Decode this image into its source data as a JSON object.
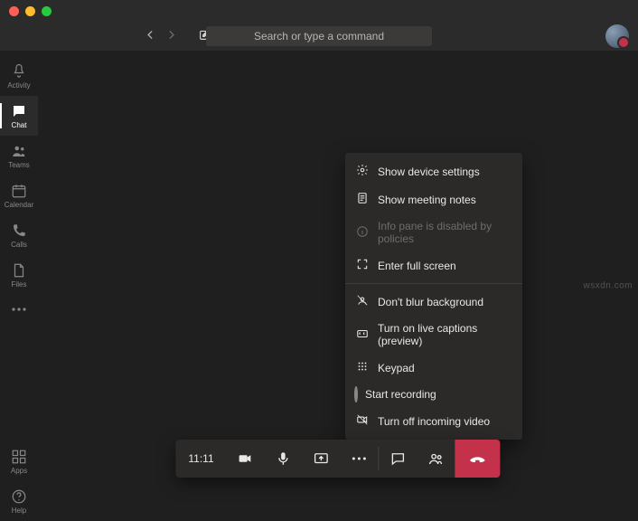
{
  "header": {
    "search_placeholder": "Search or type a command"
  },
  "sidebar": {
    "items": [
      {
        "label": "Activity",
        "name": "sidebar-item-activity"
      },
      {
        "label": "Chat",
        "name": "sidebar-item-chat"
      },
      {
        "label": "Teams",
        "name": "sidebar-item-teams"
      },
      {
        "label": "Calendar",
        "name": "sidebar-item-calendar"
      },
      {
        "label": "Calls",
        "name": "sidebar-item-calls"
      },
      {
        "label": "Files",
        "name": "sidebar-item-files"
      }
    ],
    "bottom": [
      {
        "label": "Apps",
        "name": "sidebar-item-apps"
      },
      {
        "label": "Help",
        "name": "sidebar-item-help"
      }
    ],
    "active_index": 1
  },
  "call": {
    "duration": "11:11"
  },
  "menu": {
    "items": [
      {
        "label": "Show device settings",
        "icon": "gear-icon",
        "disabled": false
      },
      {
        "label": "Show meeting notes",
        "icon": "notes-icon",
        "disabled": false
      },
      {
        "label": "Info pane is disabled by policies",
        "icon": "info-icon",
        "disabled": true
      },
      {
        "label": "Enter full screen",
        "icon": "fullscreen-icon",
        "disabled": false
      }
    ],
    "items2": [
      {
        "label": "Don't blur background",
        "icon": "blur-icon",
        "disabled": false
      },
      {
        "label": "Turn on live captions (preview)",
        "icon": "captions-icon",
        "disabled": false
      },
      {
        "label": "Keypad",
        "icon": "keypad-icon",
        "disabled": false
      },
      {
        "label": "Start recording",
        "icon": "record-icon",
        "disabled": false
      },
      {
        "label": "Turn off incoming video",
        "icon": "incoming-video-off-icon",
        "disabled": false
      }
    ]
  },
  "watermark": "wsxdn.com"
}
